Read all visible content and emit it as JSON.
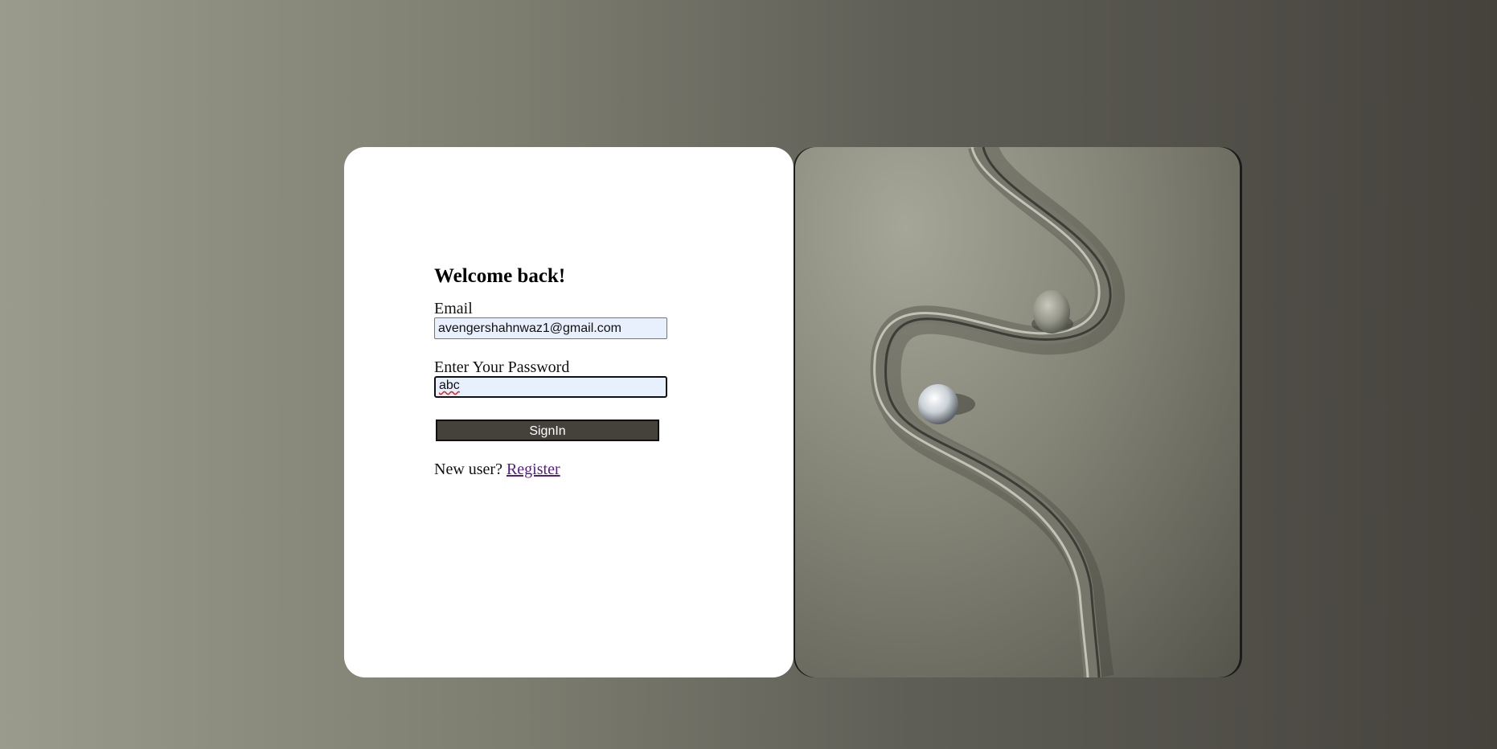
{
  "login": {
    "heading": "Welcome back!",
    "email_label": "Email",
    "email_value": "avengershahnwaz1@gmail.com",
    "password_label": "Enter Your Password",
    "password_value": "abc",
    "signin_label": "SignIn",
    "new_user_text": "New user?",
    "register_link": "Register"
  },
  "colors": {
    "button": "#45423c",
    "link": "#551a8b",
    "input_fill": "#e8f0fe"
  },
  "illustration": {
    "icon": "abstract-ribbon-spheres-image"
  }
}
